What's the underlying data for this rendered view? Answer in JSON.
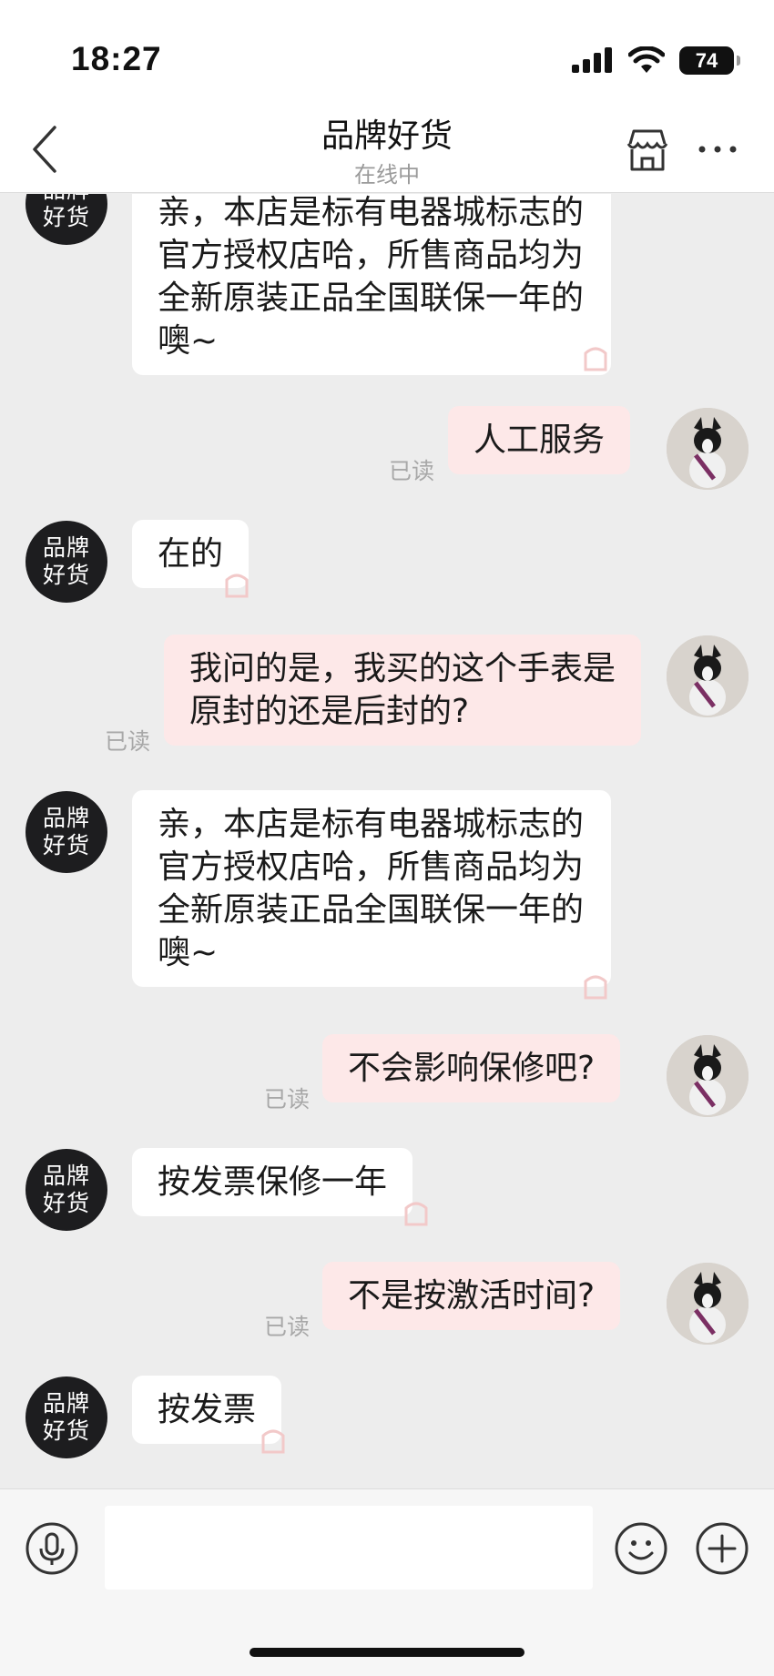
{
  "status_bar": {
    "time": "18:27",
    "battery": "74"
  },
  "header": {
    "title": "品牌好货",
    "subtitle": "在线中"
  },
  "shop_avatar": {
    "line1": "品牌",
    "line2": "好货"
  },
  "read_label": "已读",
  "messages": [
    {
      "side": "left",
      "text": "亲，本店是标有电器城标志的官方授权店哈，所售商品均为全新原装正品全国联保一年的噢~"
    },
    {
      "side": "right",
      "text": "人工服务"
    },
    {
      "side": "left",
      "text": "在的"
    },
    {
      "side": "right",
      "text": "我问的是，我买的这个手表是原封的还是后封的?"
    },
    {
      "side": "left",
      "text": "亲，本店是标有电器城标志的官方授权店哈，所售商品均为全新原装正品全国联保一年的噢~"
    },
    {
      "side": "right",
      "text": "不会影响保修吧?"
    },
    {
      "side": "left",
      "text": "按发票保修一年"
    },
    {
      "side": "right",
      "text": "不是按激活时间?"
    },
    {
      "side": "left",
      "text": "按发票"
    }
  ],
  "colors": {
    "chat_bg": "#ededed",
    "left_bubble": "#ffffff",
    "right_bubble": "#fde8e8",
    "shop_avatar_bg": "#1d1d1f"
  },
  "icons": {
    "back": "chevron-left-icon",
    "store": "store-icon",
    "more": "more-horizontal-icon",
    "mic": "microphone-icon",
    "emoji": "smiley-icon",
    "plus": "plus-icon"
  }
}
